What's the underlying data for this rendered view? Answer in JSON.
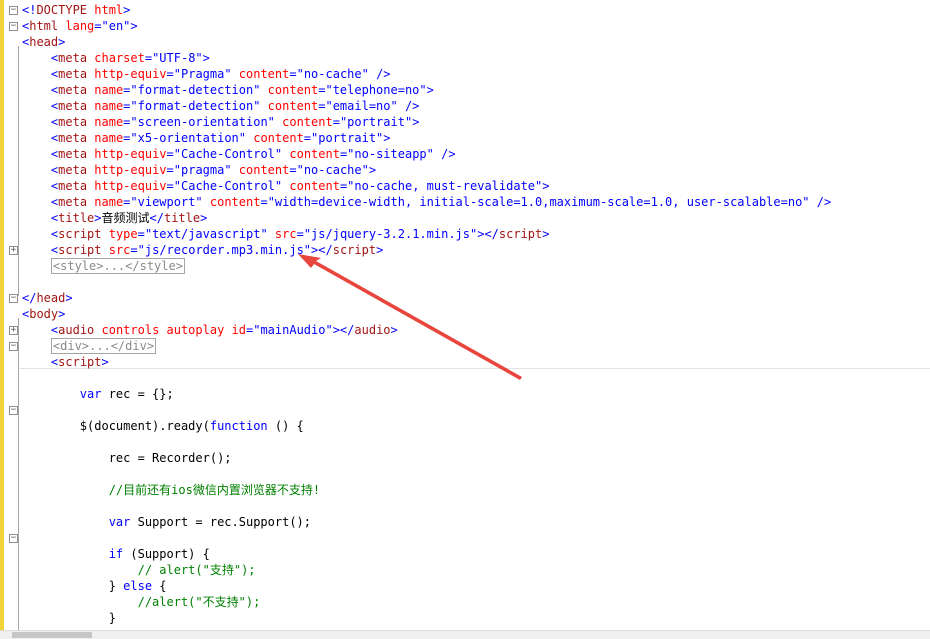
{
  "lines": [
    [
      {
        "c": "delim",
        "t": "<!"
      },
      {
        "c": "tag",
        "t": "DOCTYPE"
      },
      {
        "c": "attr",
        "t": " html"
      },
      {
        "c": "delim",
        "t": ">"
      }
    ],
    [
      {
        "c": "delim",
        "t": "<"
      },
      {
        "c": "tag",
        "t": "html"
      },
      {
        "c": "attr",
        "t": " lang"
      },
      {
        "c": "delim",
        "t": "="
      },
      {
        "c": "val",
        "t": "\"en\""
      },
      {
        "c": "delim",
        "t": ">"
      }
    ],
    [
      {
        "c": "delim",
        "t": "<"
      },
      {
        "c": "tag",
        "t": "head"
      },
      {
        "c": "delim",
        "t": ">"
      }
    ],
    [
      {
        "c": "txt",
        "t": "    "
      },
      {
        "c": "delim",
        "t": "<"
      },
      {
        "c": "tag",
        "t": "meta"
      },
      {
        "c": "attr",
        "t": " charset"
      },
      {
        "c": "delim",
        "t": "="
      },
      {
        "c": "val",
        "t": "\"UTF-8\""
      },
      {
        "c": "delim",
        "t": ">"
      }
    ],
    [
      {
        "c": "txt",
        "t": "    "
      },
      {
        "c": "delim",
        "t": "<"
      },
      {
        "c": "tag",
        "t": "meta"
      },
      {
        "c": "attr",
        "t": " http-equiv"
      },
      {
        "c": "delim",
        "t": "="
      },
      {
        "c": "val",
        "t": "\"Pragma\""
      },
      {
        "c": "attr",
        "t": " content"
      },
      {
        "c": "delim",
        "t": "="
      },
      {
        "c": "val",
        "t": "\"no-cache\""
      },
      {
        "c": "delim",
        "t": " />"
      }
    ],
    [
      {
        "c": "txt",
        "t": "    "
      },
      {
        "c": "delim",
        "t": "<"
      },
      {
        "c": "tag",
        "t": "meta"
      },
      {
        "c": "attr",
        "t": " name"
      },
      {
        "c": "delim",
        "t": "="
      },
      {
        "c": "val",
        "t": "\"format-detection\""
      },
      {
        "c": "attr",
        "t": " content"
      },
      {
        "c": "delim",
        "t": "="
      },
      {
        "c": "val",
        "t": "\"telephone=no\""
      },
      {
        "c": "delim",
        "t": ">"
      }
    ],
    [
      {
        "c": "txt",
        "t": "    "
      },
      {
        "c": "delim",
        "t": "<"
      },
      {
        "c": "tag",
        "t": "meta"
      },
      {
        "c": "attr",
        "t": " name"
      },
      {
        "c": "delim",
        "t": "="
      },
      {
        "c": "val",
        "t": "\"format-detection\""
      },
      {
        "c": "attr",
        "t": " content"
      },
      {
        "c": "delim",
        "t": "="
      },
      {
        "c": "val",
        "t": "\"email=no\""
      },
      {
        "c": "delim",
        "t": " />"
      }
    ],
    [
      {
        "c": "txt",
        "t": "    "
      },
      {
        "c": "delim",
        "t": "<"
      },
      {
        "c": "tag",
        "t": "meta"
      },
      {
        "c": "attr",
        "t": " name"
      },
      {
        "c": "delim",
        "t": "="
      },
      {
        "c": "val",
        "t": "\"screen-orientation\""
      },
      {
        "c": "attr",
        "t": " content"
      },
      {
        "c": "delim",
        "t": "="
      },
      {
        "c": "val",
        "t": "\"portrait\""
      },
      {
        "c": "delim",
        "t": ">"
      }
    ],
    [
      {
        "c": "txt",
        "t": "    "
      },
      {
        "c": "delim",
        "t": "<"
      },
      {
        "c": "tag",
        "t": "meta"
      },
      {
        "c": "attr",
        "t": " name"
      },
      {
        "c": "delim",
        "t": "="
      },
      {
        "c": "val",
        "t": "\"x5-orientation\""
      },
      {
        "c": "attr",
        "t": " content"
      },
      {
        "c": "delim",
        "t": "="
      },
      {
        "c": "val",
        "t": "\"portrait\""
      },
      {
        "c": "delim",
        "t": ">"
      }
    ],
    [
      {
        "c": "txt",
        "t": "    "
      },
      {
        "c": "delim",
        "t": "<"
      },
      {
        "c": "tag",
        "t": "meta"
      },
      {
        "c": "attr",
        "t": " http-equiv"
      },
      {
        "c": "delim",
        "t": "="
      },
      {
        "c": "val",
        "t": "\"Cache-Control\""
      },
      {
        "c": "attr",
        "t": " content"
      },
      {
        "c": "delim",
        "t": "="
      },
      {
        "c": "val",
        "t": "\"no-siteapp\""
      },
      {
        "c": "delim",
        "t": " />"
      }
    ],
    [
      {
        "c": "txt",
        "t": "    "
      },
      {
        "c": "delim",
        "t": "<"
      },
      {
        "c": "tag",
        "t": "meta"
      },
      {
        "c": "attr",
        "t": " http-equiv"
      },
      {
        "c": "delim",
        "t": "="
      },
      {
        "c": "val",
        "t": "\"pragma\""
      },
      {
        "c": "attr",
        "t": " content"
      },
      {
        "c": "delim",
        "t": "="
      },
      {
        "c": "val",
        "t": "\"no-cache\""
      },
      {
        "c": "delim",
        "t": ">"
      }
    ],
    [
      {
        "c": "txt",
        "t": "    "
      },
      {
        "c": "delim",
        "t": "<"
      },
      {
        "c": "tag",
        "t": "meta"
      },
      {
        "c": "attr",
        "t": " http-equiv"
      },
      {
        "c": "delim",
        "t": "="
      },
      {
        "c": "val",
        "t": "\"Cache-Control\""
      },
      {
        "c": "attr",
        "t": " content"
      },
      {
        "c": "delim",
        "t": "="
      },
      {
        "c": "val",
        "t": "\"no-cache, must-revalidate\""
      },
      {
        "c": "delim",
        "t": ">"
      }
    ],
    [
      {
        "c": "txt",
        "t": "    "
      },
      {
        "c": "delim",
        "t": "<"
      },
      {
        "c": "tag",
        "t": "meta"
      },
      {
        "c": "attr",
        "t": " name"
      },
      {
        "c": "delim",
        "t": "="
      },
      {
        "c": "val",
        "t": "\"viewport\""
      },
      {
        "c": "attr",
        "t": " content"
      },
      {
        "c": "delim",
        "t": "="
      },
      {
        "c": "val",
        "t": "\"width=device-width, initial-scale=1.0,maximum-scale=1.0, user-scalable=no\""
      },
      {
        "c": "delim",
        "t": " />"
      }
    ],
    [
      {
        "c": "txt",
        "t": "    "
      },
      {
        "c": "delim",
        "t": "<"
      },
      {
        "c": "tag",
        "t": "title"
      },
      {
        "c": "delim",
        "t": ">"
      },
      {
        "c": "txt",
        "t": "音频测试"
      },
      {
        "c": "delim",
        "t": "</"
      },
      {
        "c": "tag",
        "t": "title"
      },
      {
        "c": "delim",
        "t": ">"
      }
    ],
    [
      {
        "c": "txt",
        "t": "    "
      },
      {
        "c": "delim",
        "t": "<"
      },
      {
        "c": "tag",
        "t": "script"
      },
      {
        "c": "attr",
        "t": " type"
      },
      {
        "c": "delim",
        "t": "="
      },
      {
        "c": "val",
        "t": "\"text/javascript\""
      },
      {
        "c": "attr",
        "t": " src"
      },
      {
        "c": "delim",
        "t": "="
      },
      {
        "c": "val",
        "t": "\"js/jquery-3.2.1.min.js\""
      },
      {
        "c": "delim",
        "t": "></"
      },
      {
        "c": "tag",
        "t": "script"
      },
      {
        "c": "delim",
        "t": ">"
      }
    ],
    [
      {
        "c": "txt",
        "t": "    "
      },
      {
        "c": "delim",
        "t": "<"
      },
      {
        "c": "tag",
        "t": "script"
      },
      {
        "c": "attr",
        "t": " src"
      },
      {
        "c": "delim",
        "t": "="
      },
      {
        "c": "val",
        "t": "\"js/recorder.mp3.min.js\""
      },
      {
        "c": "delim",
        "t": "></"
      },
      {
        "c": "tag",
        "t": "script"
      },
      {
        "c": "delim",
        "t": ">"
      }
    ],
    [
      {
        "c": "txt",
        "t": "    "
      },
      {
        "c": "box",
        "t": "<style>...</style>"
      }
    ],
    [],
    [
      {
        "c": "delim",
        "t": "</"
      },
      {
        "c": "tag",
        "t": "head"
      },
      {
        "c": "delim",
        "t": ">"
      }
    ],
    [
      {
        "c": "delim",
        "t": "<"
      },
      {
        "c": "tag",
        "t": "body"
      },
      {
        "c": "delim",
        "t": ">"
      }
    ],
    [
      {
        "c": "txt",
        "t": "    "
      },
      {
        "c": "delim",
        "t": "<"
      },
      {
        "c": "tag",
        "t": "audio"
      },
      {
        "c": "attr",
        "t": " controls autoplay id"
      },
      {
        "c": "delim",
        "t": "="
      },
      {
        "c": "val",
        "t": "\"mainAudio\""
      },
      {
        "c": "delim",
        "t": "></"
      },
      {
        "c": "tag",
        "t": "audio"
      },
      {
        "c": "delim",
        "t": ">"
      }
    ],
    [
      {
        "c": "txt",
        "t": "    "
      },
      {
        "c": "box",
        "t": "<div>...</div>"
      }
    ],
    [
      {
        "c": "txt",
        "t": "    "
      },
      {
        "c": "delim",
        "t": "<"
      },
      {
        "c": "tag",
        "t": "script"
      },
      {
        "c": "delim",
        "t": ">"
      }
    ],
    [],
    [
      {
        "c": "txt",
        "t": "        "
      },
      {
        "c": "kw",
        "t": "var"
      },
      {
        "c": "id",
        "t": " rec = {};"
      }
    ],
    [],
    [
      {
        "c": "txt",
        "t": "        "
      },
      {
        "c": "id",
        "t": "$(document).ready("
      },
      {
        "c": "kw",
        "t": "function"
      },
      {
        "c": "id",
        "t": " () {"
      }
    ],
    [],
    [
      {
        "c": "txt",
        "t": "            "
      },
      {
        "c": "id",
        "t": "rec = Recorder();"
      }
    ],
    [],
    [
      {
        "c": "txt",
        "t": "            "
      },
      {
        "c": "cmt",
        "t": "//目前还有ios微信内置浏览器不支持!"
      }
    ],
    [],
    [
      {
        "c": "txt",
        "t": "            "
      },
      {
        "c": "kw",
        "t": "var"
      },
      {
        "c": "id",
        "t": " Support = rec.Support();"
      }
    ],
    [],
    [
      {
        "c": "txt",
        "t": "            "
      },
      {
        "c": "kw",
        "t": "if"
      },
      {
        "c": "id",
        "t": " (Support) {"
      }
    ],
    [
      {
        "c": "txt",
        "t": "                "
      },
      {
        "c": "cmt",
        "t": "// alert(\"支持\");"
      }
    ],
    [
      {
        "c": "txt",
        "t": "            "
      },
      {
        "c": "id",
        "t": "} "
      },
      {
        "c": "kw",
        "t": "else"
      },
      {
        "c": "id",
        "t": " {"
      }
    ],
    [
      {
        "c": "txt",
        "t": "                "
      },
      {
        "c": "cmt",
        "t": "//alert(\"不支持\");"
      }
    ],
    [
      {
        "c": "txt",
        "t": "            "
      },
      {
        "c": "id",
        "t": "}"
      }
    ]
  ],
  "fold_markers": [
    {
      "line": 1,
      "symbol": "−"
    },
    {
      "line": 2,
      "symbol": "−"
    },
    {
      "line": 16,
      "symbol": "+"
    },
    {
      "line": 19,
      "symbol": "−"
    },
    {
      "line": 21,
      "symbol": "+"
    },
    {
      "line": 22,
      "symbol": "−"
    },
    {
      "line": 26,
      "symbol": "−"
    },
    {
      "line": 34,
      "symbol": "−"
    }
  ],
  "colors": {
    "tag": "#a31515",
    "delimiter": "#0000ff",
    "attribute": "#ff0000",
    "value": "#0000ff",
    "keyword": "#0000ff",
    "comment": "#008000",
    "margin": "#f2d33a",
    "annotation_arrow": "#e8453c"
  }
}
